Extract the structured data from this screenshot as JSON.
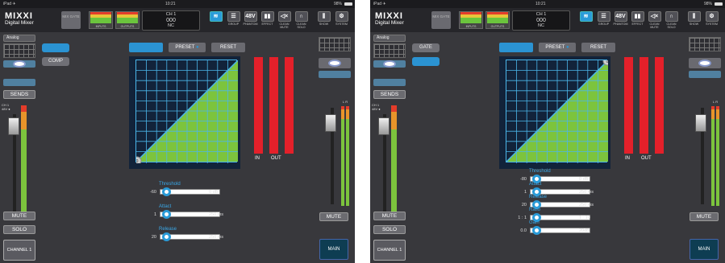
{
  "colors": {
    "accent": "#2b93d2",
    "meter_red": "#e4202a",
    "meter_green": "#7cc43d"
  },
  "status": {
    "device": "iPad ✈",
    "time": "10:21",
    "battery": "98%"
  },
  "app": {
    "brand": "MIXXI",
    "subtitle": "Digital Mixer",
    "mix_gate": "MIX\nGATE",
    "inputs": "INPUTS",
    "outputs": "OUTPUTS"
  },
  "channel_display": {
    "name": "CH 1",
    "number": "000",
    "assign": "NC"
  },
  "toolbar": [
    "GROUP",
    "PHANTOM",
    "EFFECT",
    "CLEAN MUTE",
    "CLEAN SOLO",
    "SHOW",
    "SYSTEM"
  ],
  "toolbar_icons": {
    "phantom": "48V"
  },
  "left": {
    "source": "Analog",
    "sends": "SENDS",
    "ch": "CH 1",
    "phantom": "48V ●",
    "mute": "MUTE",
    "solo": "SOLO",
    "channel": "CHANNEL 1"
  },
  "right": {
    "mute": "MUTE",
    "main": "MAIN",
    "lr": "L R"
  },
  "dyn": {
    "gate": "GATE",
    "comp": "COMP",
    "preset": "PRESET",
    "reset": "RESET",
    "in": "IN",
    "out": "OUT",
    "marker": "0"
  },
  "screen1": {
    "params": [
      {
        "name": "Threshold",
        "left": "-60",
        "right": "0 dB",
        "level": 0.05
      },
      {
        "name": "Attact",
        "left": "1",
        "right": "250 ms",
        "level": 0.05
      },
      {
        "name": "Release",
        "left": "20",
        "right": "250 ms",
        "level": 0.05
      }
    ]
  },
  "screen2": {
    "params": [
      {
        "name": "Threshold",
        "left": "-80",
        "right": "0 dB",
        "level": 0.05
      },
      {
        "name": "Attact",
        "left": "1",
        "right": "250 ms",
        "level": 0.05
      },
      {
        "name": "Release",
        "left": "20",
        "right": "250 ms",
        "level": 0.05
      },
      {
        "name": "Ratio",
        "left": "1 : 1",
        "right": "1 : 10",
        "level": 0.05
      },
      {
        "name": "Gain",
        "left": "0.0",
        "right": "20dB",
        "level": 0.05
      }
    ]
  }
}
